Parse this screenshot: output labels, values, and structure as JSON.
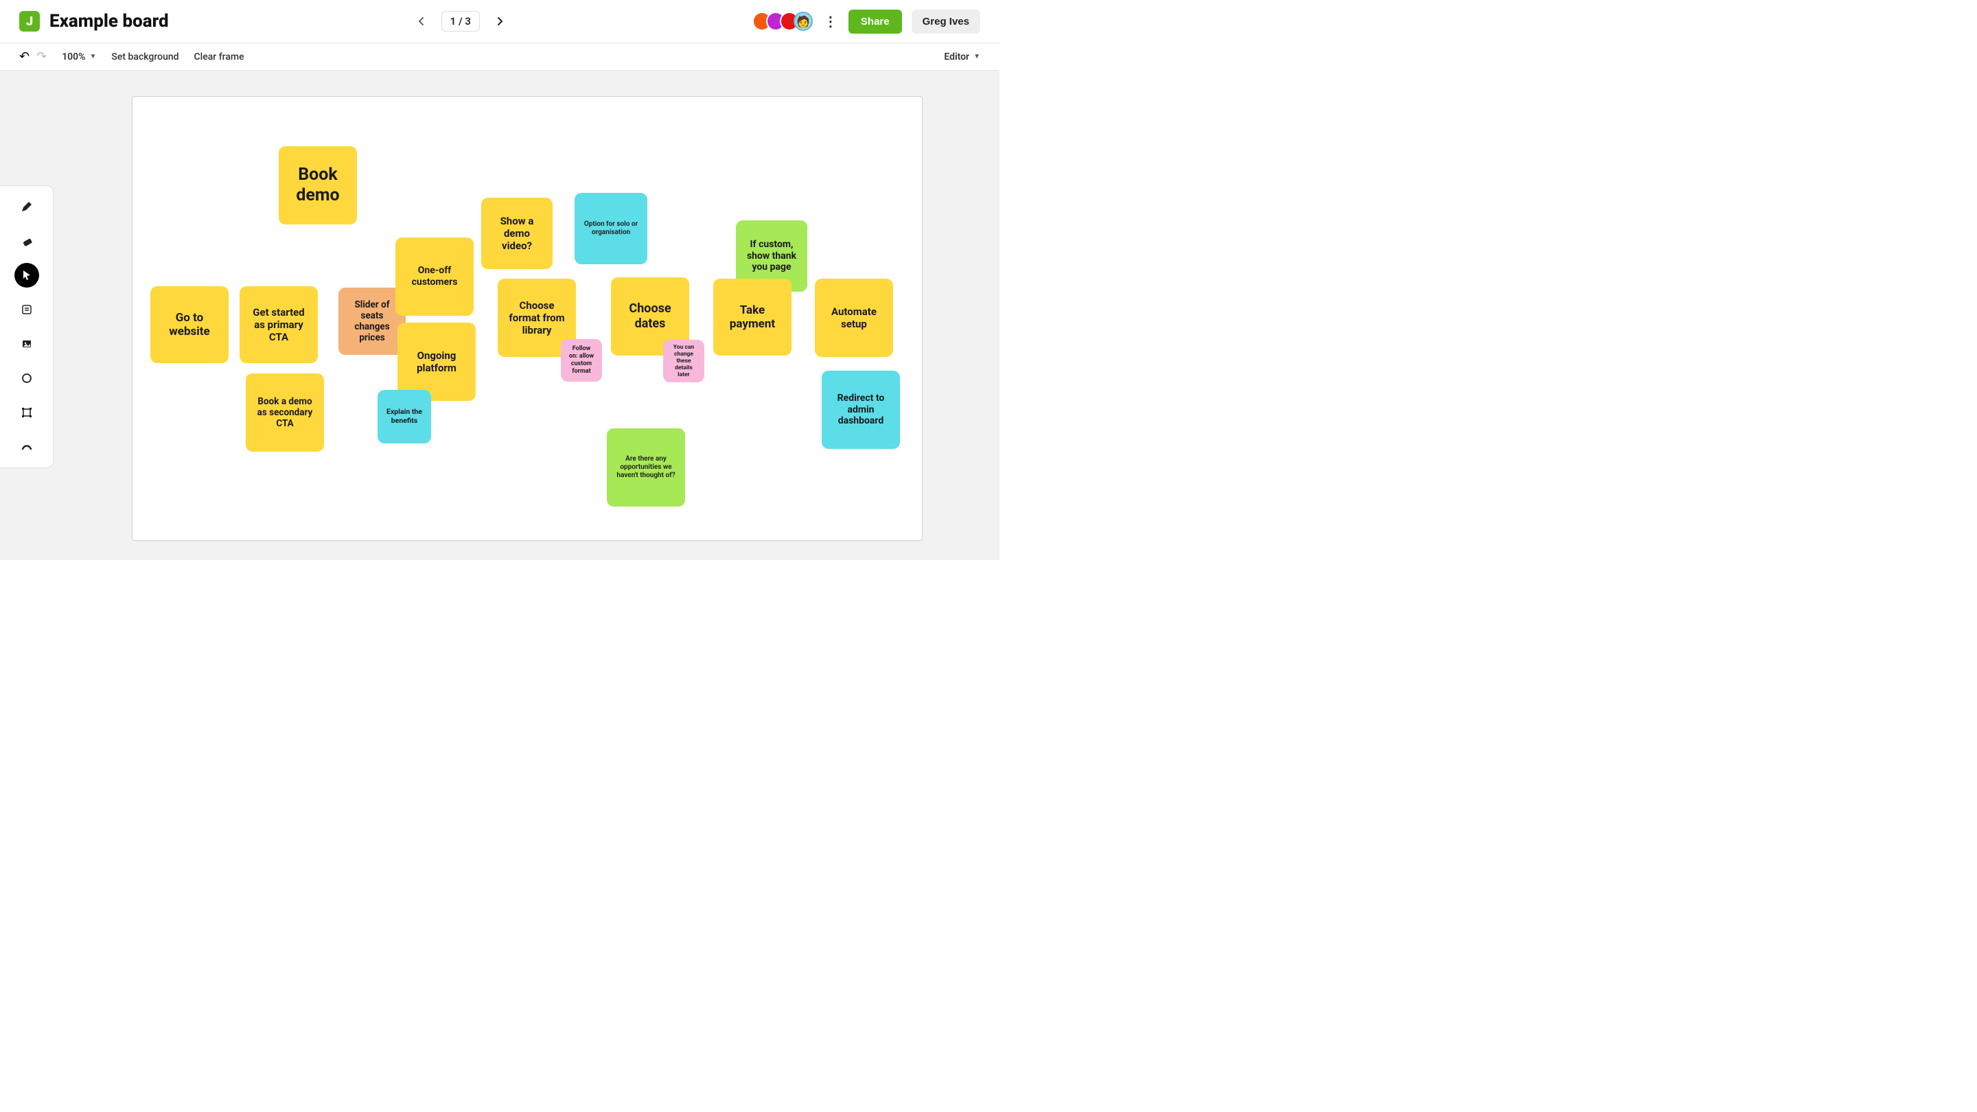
{
  "header": {
    "logo_letter": "J",
    "board_title": "Example board",
    "page_indicator": "1 / 3",
    "share_label": "Share",
    "user_name": "Greg Ives"
  },
  "toolbar": {
    "zoom": "100%",
    "set_bg": "Set background",
    "clear_frame": "Clear frame",
    "mode": "Editor"
  },
  "notes": {
    "book_demo": "Book demo",
    "go_to_website": "Go to website",
    "get_started": "Get started as primary CTA",
    "book_demo_secondary": "Book a demo as secondary CTA",
    "slider_seats": "Slider of seats changes prices",
    "one_off": "One-off customers",
    "ongoing": "Ongoing platform",
    "explain_benefits": "Explain the benefits",
    "show_demo": "Show a demo video?",
    "choose_format": "Choose format from library",
    "option_solo": "Option for solo or organisation",
    "follow_on": "Follow on: allow custom format",
    "choose_dates": "Choose dates",
    "change_later": "You can change these details later",
    "opportunities": "Are there any opportunities we haven't thought of?",
    "if_custom": "If custom, show thank you page",
    "take_payment": "Take payment",
    "automate_setup": "Automate setup",
    "redirect_admin": "Redirect to admin dashboard"
  }
}
